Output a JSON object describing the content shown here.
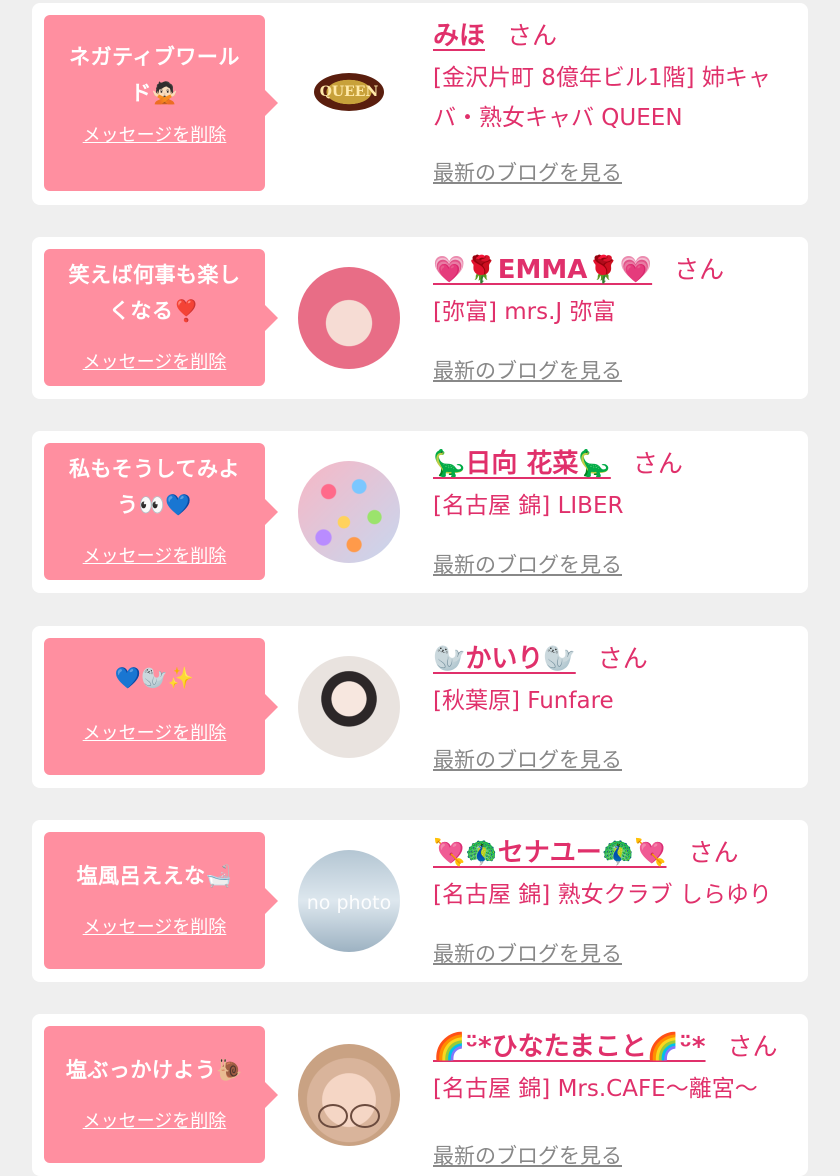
{
  "delete_label": "メッセージを削除",
  "blog_label": "最新のブログを見る",
  "san_label": "さん",
  "items": [
    {
      "message": "ネガティブワール\nド🙅🏻",
      "name": "みほ",
      "shop": "[金沢片町 8億年ビル1階] 姉キャ\nバ・熟女キャバ QUEEN",
      "logo_text": "QUEEN"
    },
    {
      "message": "笑えば何事も楽し\nくなる❣️",
      "name": "💗🌹EMMA🌹💗",
      "shop": "[弥富] mrs.J 弥富"
    },
    {
      "message": "私もそうしてみよ\nう👀💙",
      "name": "🦕日向 花菜🦕",
      "shop": "[名古屋 錦] LIBER"
    },
    {
      "message": "💙🦭✨",
      "name": "🦭かいり🦭",
      "shop": "[秋葉原] Funfare"
    },
    {
      "message": "塩風呂ええな🛁",
      "name": "💘🦚セナユー🦚💘",
      "shop": "[名古屋 錦] 熟女クラブ しらゆり",
      "avatar_text": "no photo"
    },
    {
      "message": "塩ぶっかけよう🐌",
      "name": "🌈ᵕ̈*ひなたまこと🌈ᵕ̈*",
      "shop": "[名古屋 錦] Mrs.CAFE〜離宮〜"
    }
  ]
}
